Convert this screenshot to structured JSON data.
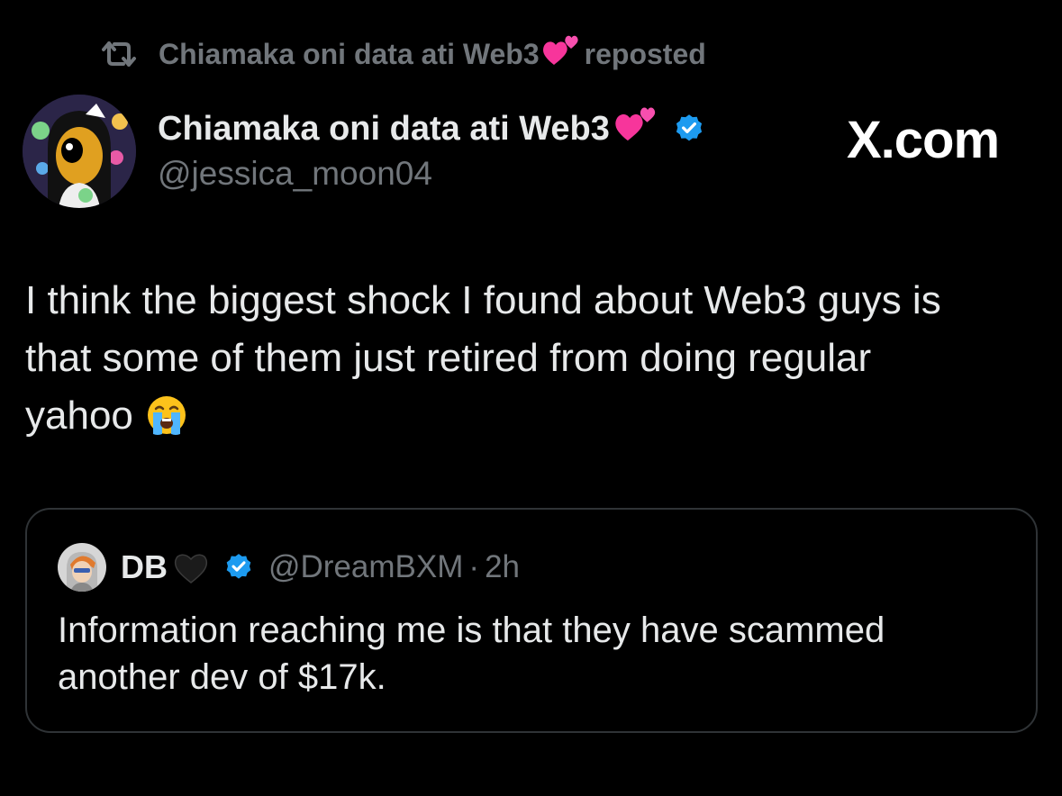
{
  "repost": {
    "user": "Chiamaka oni data ati Web3",
    "emoji": "two-hearts-emoji",
    "action": "reposted"
  },
  "author": {
    "name": "Chiamaka oni data ati Web3",
    "name_emoji": "two-hearts-emoji",
    "handle": "@jessica_moon04",
    "verified": true,
    "avatar": "avatar-icon"
  },
  "brand": "X.com",
  "post": {
    "lines": [
      "I think the biggest shock I found about Web3 guys is",
      "that some of them just retired from doing regular",
      "yahoo"
    ],
    "emoji": "loudly-crying-face-emoji"
  },
  "quote": {
    "name": "DB",
    "name_emoji": "black-heart-emoji",
    "verified": true,
    "handle": "@DreamBXM",
    "separator": "·",
    "time": "2h",
    "lines": [
      "Information reaching me is that they have scammed",
      "another dev of $17k."
    ]
  },
  "colors": {
    "background": "#000000",
    "text": "#e7e9ea",
    "muted": "#71767b",
    "verified": "#1d9bf0",
    "border": "#2f3336"
  }
}
